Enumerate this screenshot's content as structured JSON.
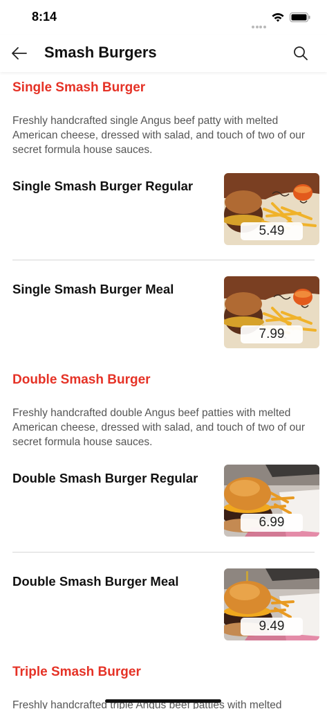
{
  "status_bar": {
    "time": "8:14"
  },
  "header": {
    "title": "Smash Burgers"
  },
  "sections": [
    {
      "title": "Single Smash Burger",
      "description": "Freshly handcrafted single Angus beef patty with melted American cheese, dressed with salad, and touch of two of our secret formula house sauces.",
      "items": [
        {
          "name": "Single Smash Burger Regular",
          "price": "5.49"
        },
        {
          "name": "Single Smash Burger Meal",
          "price": "7.99"
        }
      ]
    },
    {
      "title": "Double Smash Burger",
      "description": "Freshly handcrafted double Angus beef patties with melted American cheese, dressed with salad, and touch of two of our secret formula house sauces.",
      "items": [
        {
          "name": "Double Smash Burger Regular",
          "price": "6.99"
        },
        {
          "name": "Double Smash Burger Meal",
          "price": "9.49"
        }
      ]
    },
    {
      "title": "Triple Smash Burger",
      "description": "Freshly handcrafted triple Angus beef patties with melted"
    }
  ],
  "colors": {
    "accent": "#e53226",
    "text": "#111111",
    "muted": "#555555"
  },
  "icons": {
    "back": "arrow-left-icon",
    "search": "search-icon",
    "wifi": "wifi-icon",
    "battery": "battery-icon"
  }
}
